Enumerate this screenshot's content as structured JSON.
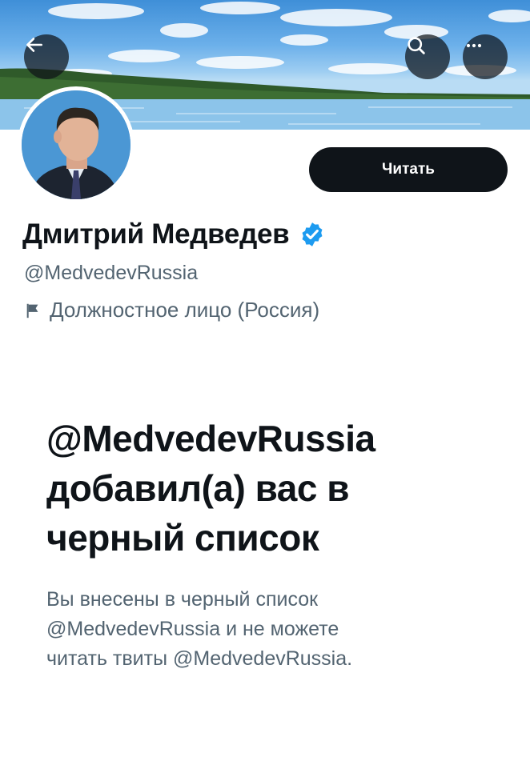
{
  "profile": {
    "display_name": "Дмитрий Медведев",
    "handle": "@MedvedevRussia",
    "category": "Должностное лицо (Россия)",
    "follow_label": "Читать"
  },
  "blocked": {
    "title_lines": [
      "@MedvedevRussia",
      "добавил(а) вас в",
      "черный список"
    ],
    "description_lines": [
      "Вы внесены в черный список",
      "@MedvedevRussia и не можете",
      "читать твиты @MedvedevRussia."
    ]
  },
  "icons": {
    "back": "arrow-left-icon",
    "search": "search-icon",
    "more": "more-horizontal-icon",
    "verified": "verified-badge-icon",
    "category": "flag-icon"
  },
  "colors": {
    "primary_text": "#0f1419",
    "secondary_text": "#536471",
    "verified_blue": "#1d9bf0",
    "button_bg": "#0f1419"
  }
}
